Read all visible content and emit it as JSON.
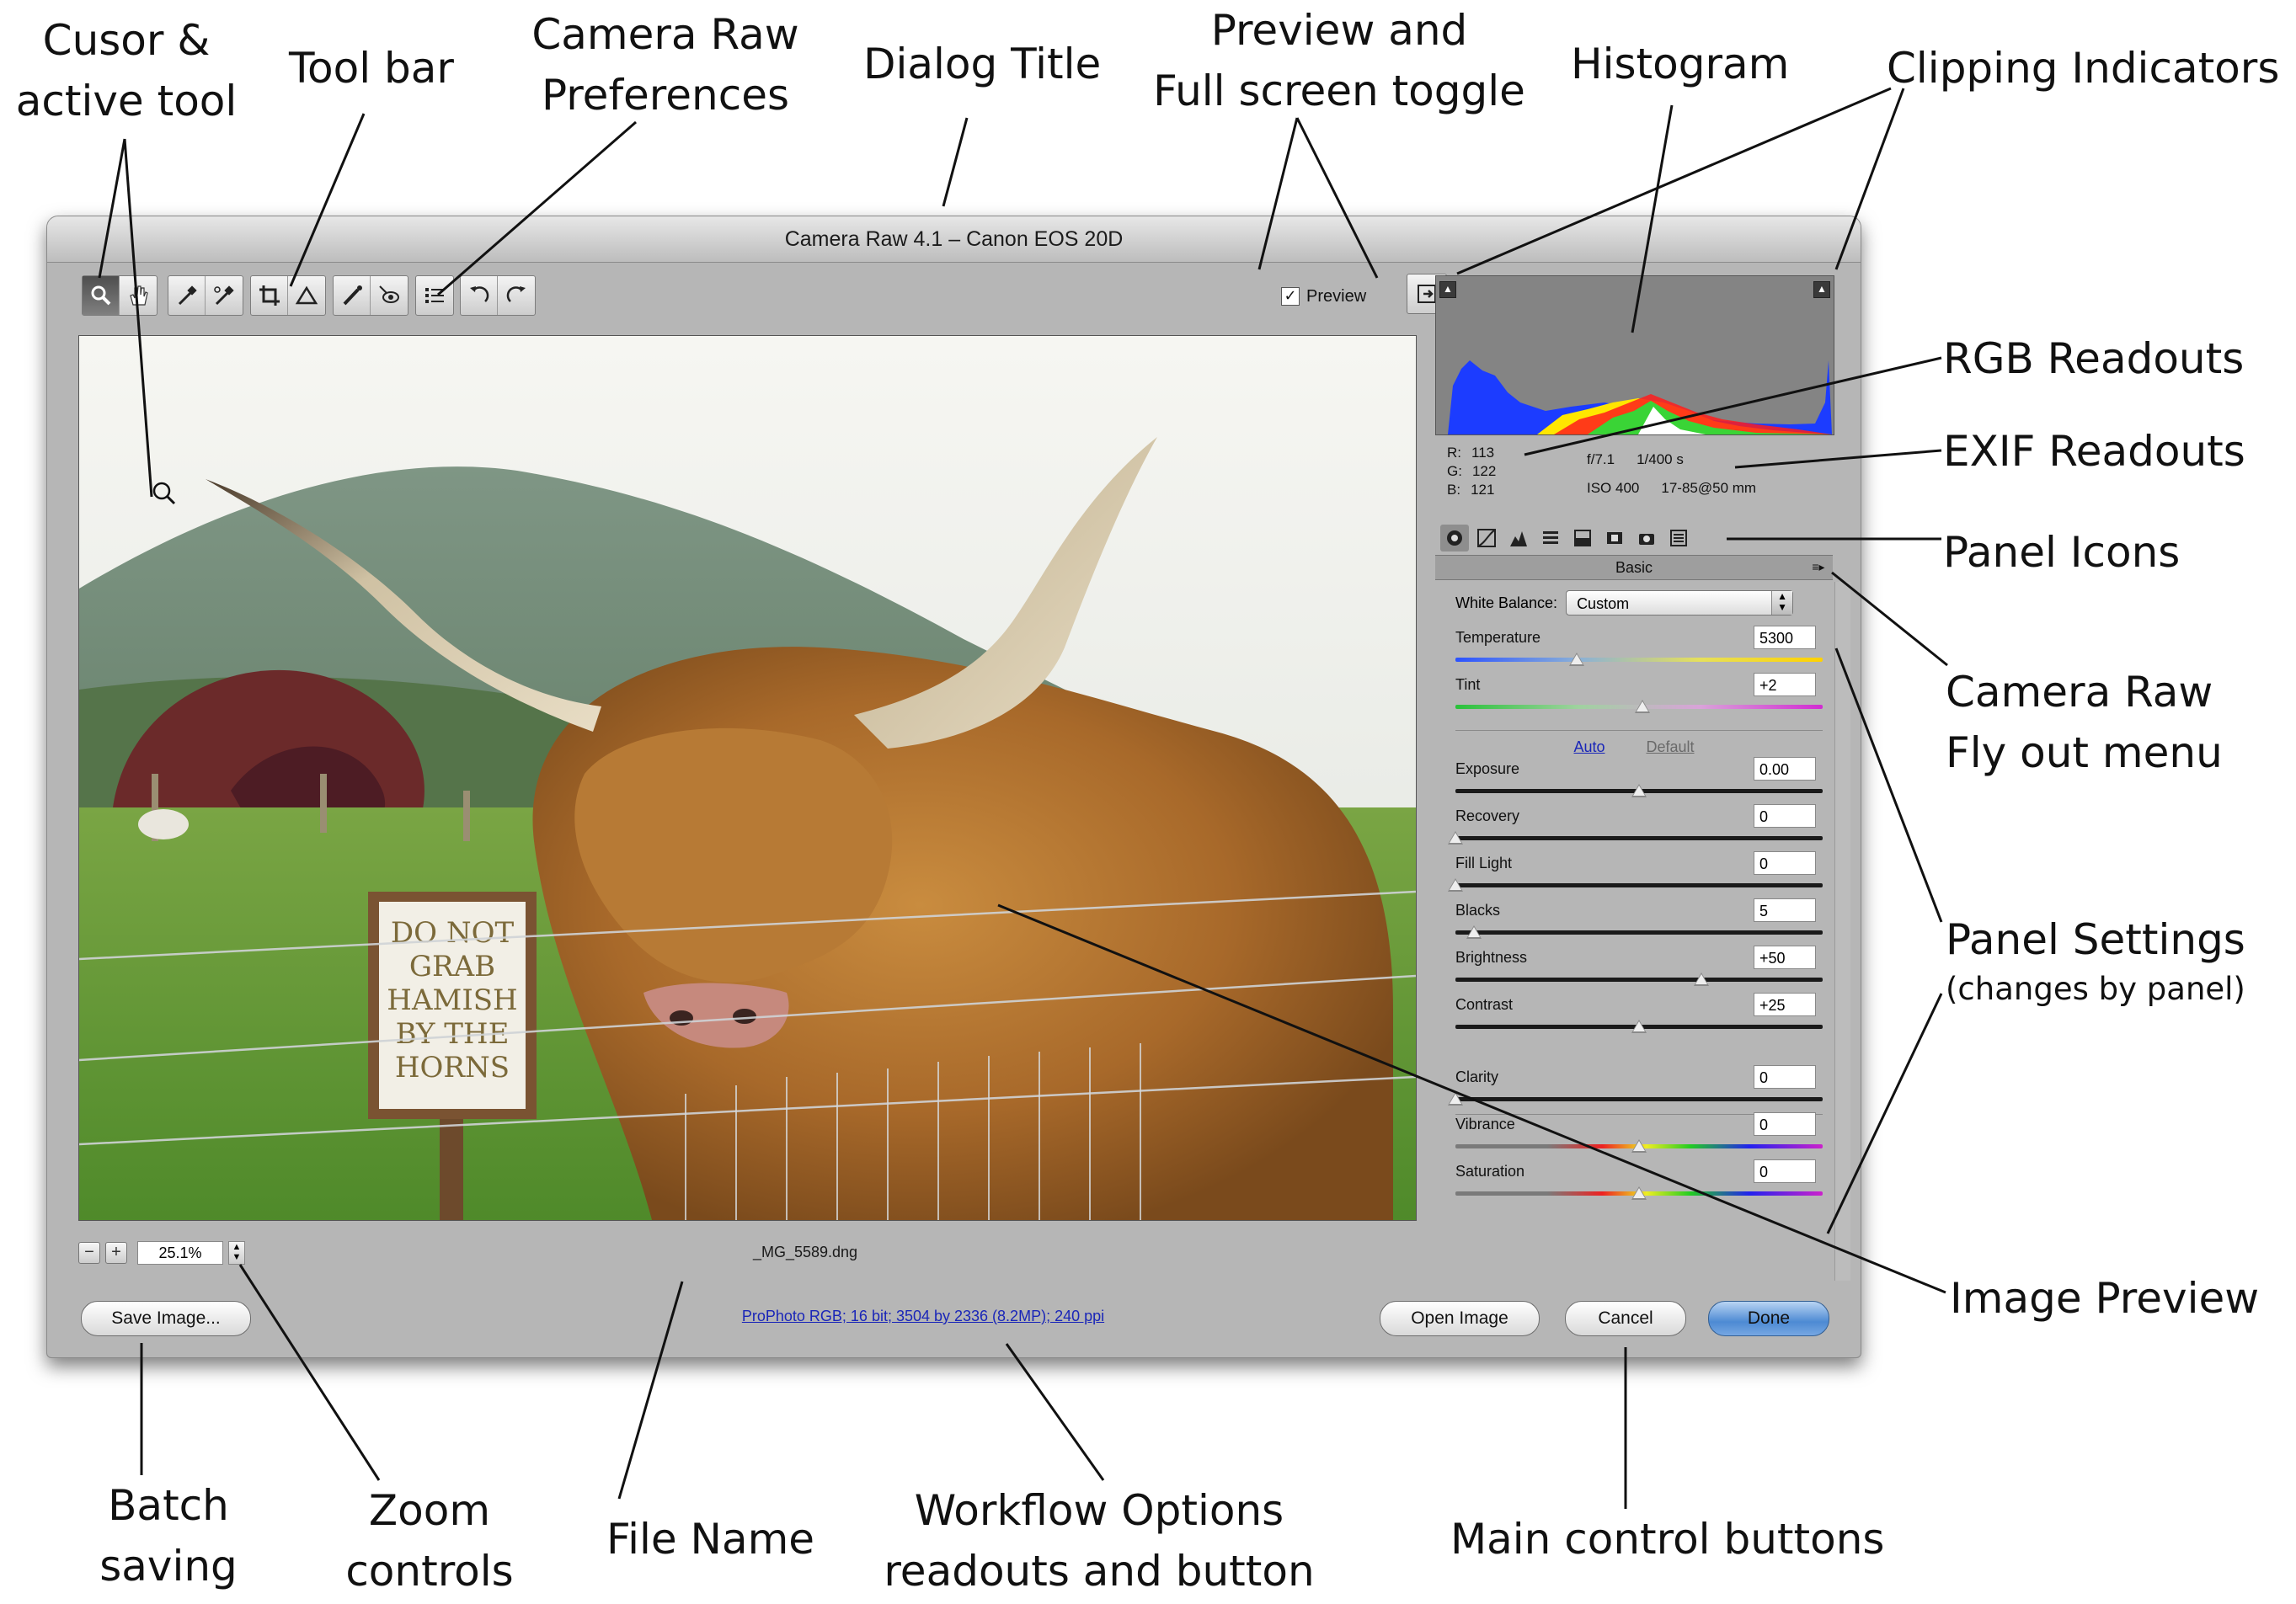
{
  "callouts": {
    "cursor": [
      "Cusor &",
      "active tool"
    ],
    "toolbar": "Tool bar",
    "prefs": [
      "Camera Raw",
      "Preferences"
    ],
    "dialog_title": "Dialog Title",
    "preview_toggle": [
      "Preview and",
      "Full screen toggle"
    ],
    "histogram": "Histogram",
    "clipping": "Clipping Indicators",
    "rgb": "RGB Readouts",
    "exif": "EXIF Readouts",
    "panel_icons": "Panel Icons",
    "flyout": [
      "Camera Raw",
      "Fly out menu"
    ],
    "panel_settings": "Panel Settings",
    "panel_settings_sub": "(changes by panel)",
    "image_preview": "Image Preview",
    "batch": [
      "Batch",
      "saving"
    ],
    "zoom": [
      "Zoom",
      "controls"
    ],
    "file_name": "File Name",
    "workflow": [
      "Workflow Options",
      "readouts and button"
    ],
    "main_buttons": "Main control buttons"
  },
  "dialog": {
    "title": "Camera Raw 4.1  –  Canon EOS 20D",
    "preview_label": "Preview",
    "preview_checked": true,
    "zoom_value": "25.1%",
    "file_name": "_MG_5589.dng",
    "workflow_text": "ProPhoto RGB; 16 bit; 3504 by 2336 (8.2MP); 240 ppi",
    "buttons": {
      "save": "Save Image...",
      "open": "Open Image",
      "cancel": "Cancel",
      "done": "Done"
    }
  },
  "tools": [
    "zoom-tool-icon",
    "hand-tool-icon",
    "white-balance-icon",
    "color-sampler-icon",
    "crop-icon",
    "straighten-icon",
    "spot-removal-icon",
    "red-eye-icon",
    "preferences-icon",
    "rotate-left-icon",
    "rotate-right-icon"
  ],
  "image": {
    "sign_lines": [
      "DO NOT",
      "GRAB",
      "HAMISH",
      "BY THE",
      "HORNS"
    ]
  },
  "readouts": {
    "r_label": "R:",
    "r_value": "113",
    "g_label": "G:",
    "g_value": "122",
    "b_label": "B:",
    "b_value": "121",
    "aperture": "f/7.1",
    "shutter": "1/400 s",
    "iso": "ISO 400",
    "lens": "17-85@50 mm"
  },
  "panel": {
    "header": "Basic",
    "white_balance_label": "White Balance:",
    "white_balance_value": "Custom",
    "auto": "Auto",
    "default": "Default",
    "sliders": [
      {
        "label": "Temperature",
        "value": "5300",
        "level": 0.33,
        "track": "temperature"
      },
      {
        "label": "Tint",
        "value": "+2",
        "level": 0.51,
        "track": "tint"
      },
      {
        "label": "Exposure",
        "value": "0.00",
        "level": 0.5,
        "track": "plain"
      },
      {
        "label": "Recovery",
        "value": "0",
        "level": 0.0,
        "track": "plain"
      },
      {
        "label": "Fill Light",
        "value": "0",
        "level": 0.0,
        "track": "plain"
      },
      {
        "label": "Blacks",
        "value": "5",
        "level": 0.05,
        "track": "plain"
      },
      {
        "label": "Brightness",
        "value": "+50",
        "level": 0.67,
        "track": "plain"
      },
      {
        "label": "Contrast",
        "value": "+25",
        "level": 0.5,
        "track": "plain"
      },
      {
        "label": "Clarity",
        "value": "0",
        "level": 0.0,
        "track": "plain"
      },
      {
        "label": "Vibrance",
        "value": "0",
        "level": 0.5,
        "track": "rainbow"
      },
      {
        "label": "Saturation",
        "value": "0",
        "level": 0.5,
        "track": "rainbow"
      }
    ]
  },
  "colors": {
    "accent_default_button": "#4d8ad3",
    "workflow_link": "#1a26b8"
  }
}
